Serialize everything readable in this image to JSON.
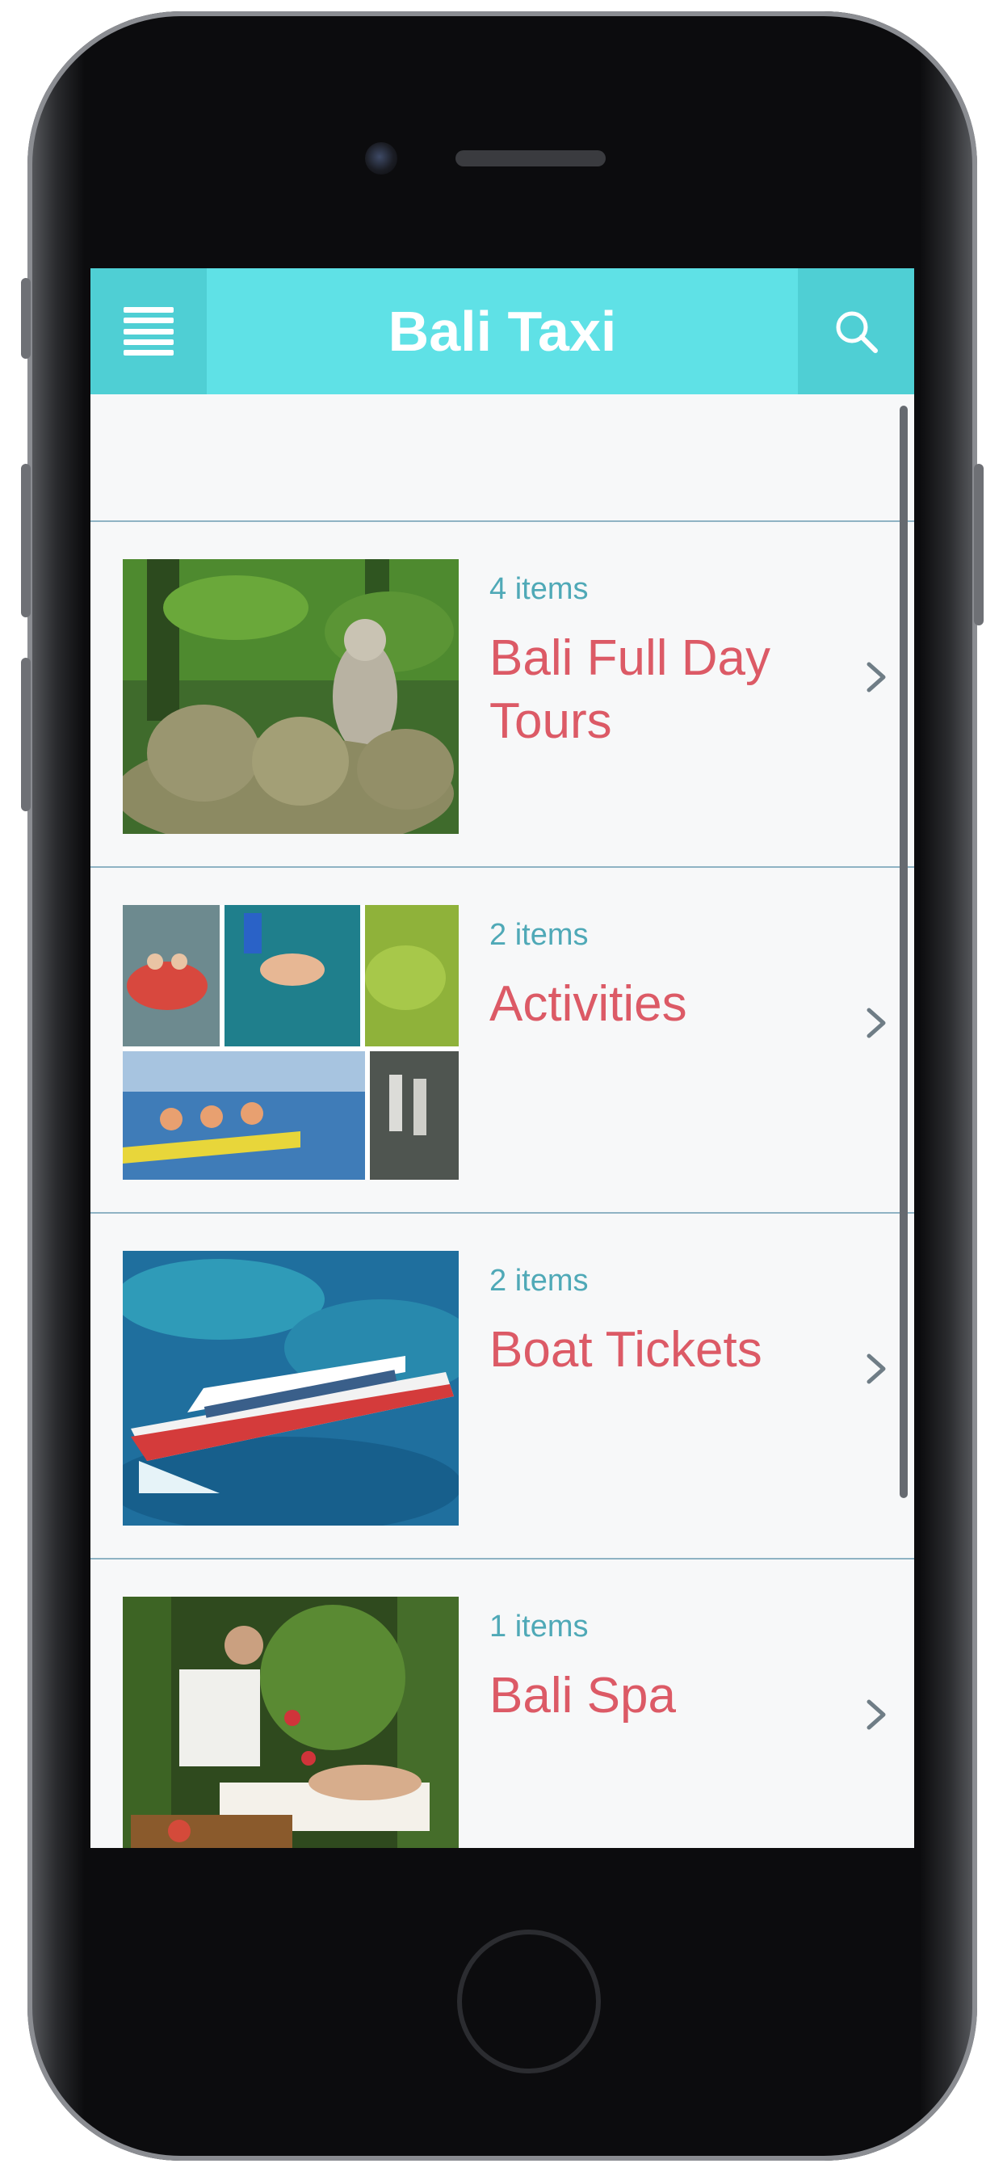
{
  "header": {
    "title": "Bali Taxi",
    "menu_icon": "hamburger-menu-icon",
    "search_icon": "search-icon",
    "accent_color": "#5fe1e6"
  },
  "categories": [
    {
      "count": "4 items",
      "title": "Bali Full Day Tours",
      "image": "monkey-statues-forest"
    },
    {
      "count": "2 items",
      "title": "Activities",
      "image": "activities-collage"
    },
    {
      "count": "2 items",
      "title": "Boat Tickets",
      "image": "speedboat-ocean"
    },
    {
      "count": "1 items",
      "title": "Bali Spa",
      "image": "spa-massage"
    }
  ],
  "colors": {
    "title_text": "#dc5a66",
    "count_text": "#4fa9b7",
    "divider": "#8fb3c4"
  }
}
